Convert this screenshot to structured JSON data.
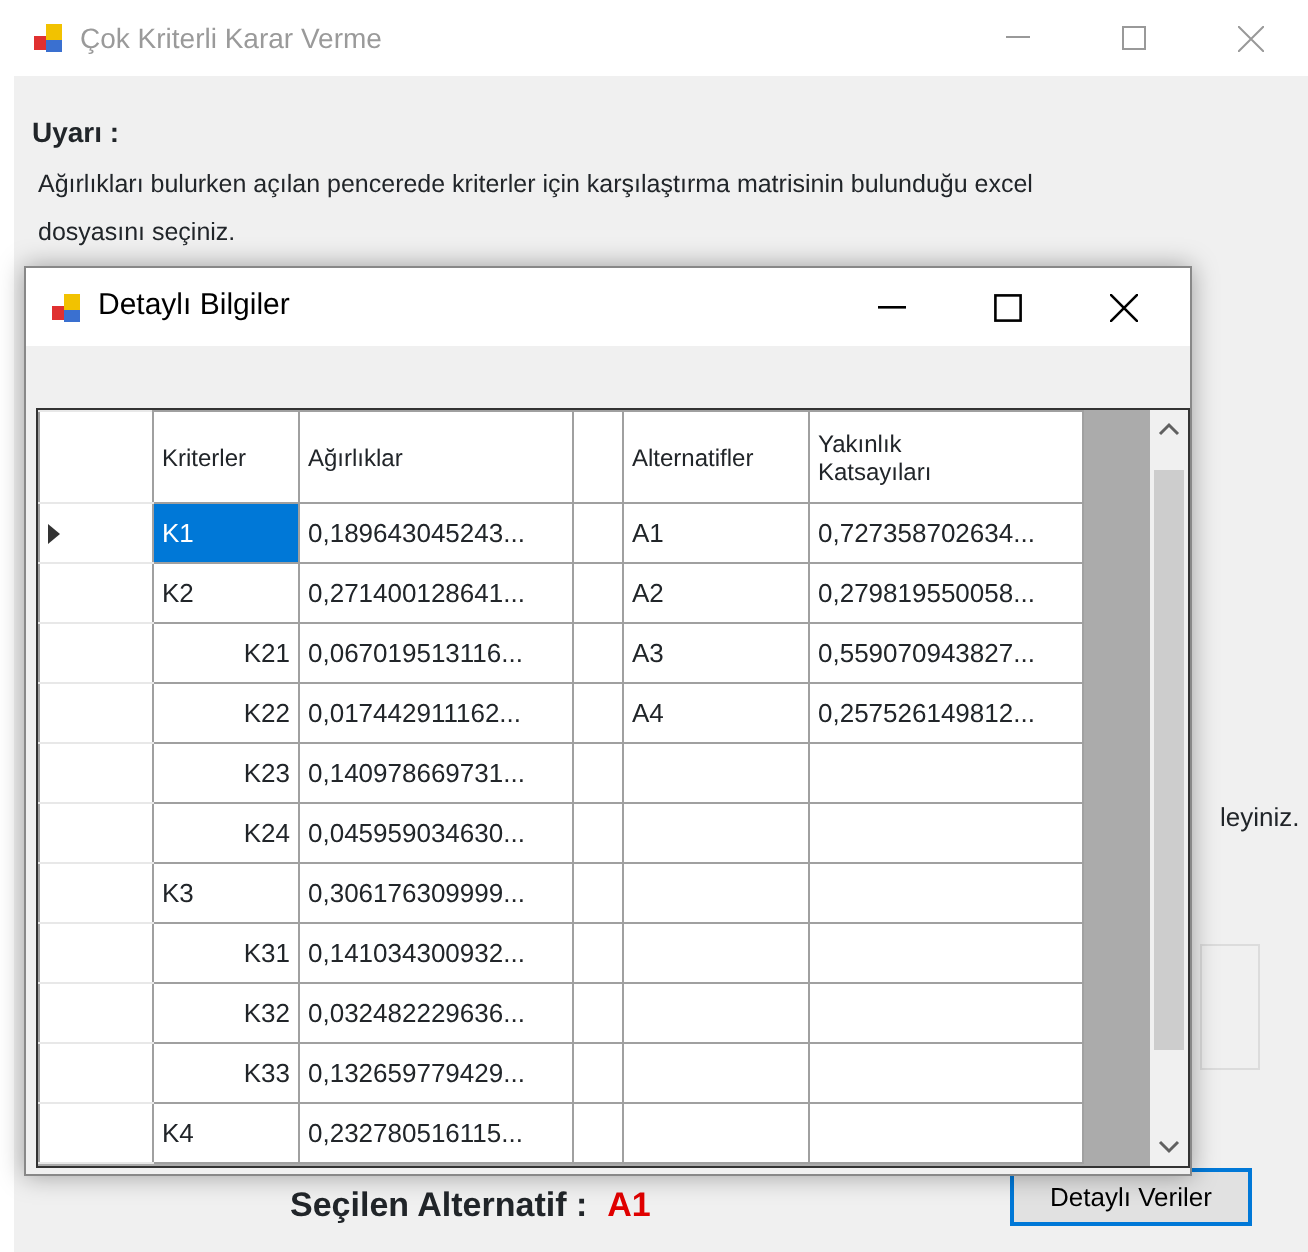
{
  "window": {
    "title": "Çok Kriterli Karar Verme"
  },
  "warning": {
    "label": "Uyarı :",
    "text": "Ağırlıkları bulurken açılan pencerede kriterler için karşılaştırma matrisinin bulunduğu excel dosyasını seçiniz."
  },
  "background_hint": "leyiniz.",
  "result": {
    "label": "Seçilen Alternatif :",
    "value": "A1"
  },
  "details_button": "Detaylı Veriler",
  "dialog": {
    "title": "Detaylı Bilgiler",
    "columns": [
      "Kriterler",
      "Ağırlıklar",
      "Alternatifler",
      "Yakınlık Katsayıları"
    ],
    "criteria": [
      {
        "name": "K1",
        "weight": "0,189643045243...",
        "selected": true
      },
      {
        "name": "K2",
        "weight": "0,271400128641...",
        "selected": false,
        "children": [
          {
            "name": "K21",
            "weight": "0,067019513116...",
            "selected": false
          },
          {
            "name": "K22",
            "weight": "0,017442911162...",
            "selected": false
          },
          {
            "name": "K23",
            "weight": "0,140978669731...",
            "selected": false
          },
          {
            "name": "K24",
            "weight": "0,045959034630...",
            "selected": false
          }
        ]
      },
      {
        "name": "K3",
        "weight": "0,306176309999...",
        "selected": false,
        "children": [
          {
            "name": "K31",
            "weight": "0,141034300932...",
            "selected": false
          },
          {
            "name": "K32",
            "weight": "0,032482229636...",
            "selected": false
          },
          {
            "name": "K33",
            "weight": "0,132659779429...",
            "selected": false
          }
        ]
      },
      {
        "name": "K4",
        "weight": "0,232780516115...",
        "selected": false
      }
    ],
    "alternatives": [
      {
        "name": "A1",
        "coefficient": "0,727358702634..."
      },
      {
        "name": "A2",
        "coefficient": "0,279819550058..."
      },
      {
        "name": "A3",
        "coefficient": "0,559070943827..."
      },
      {
        "name": "A4",
        "coefficient": "0,257526149812..."
      }
    ]
  }
}
